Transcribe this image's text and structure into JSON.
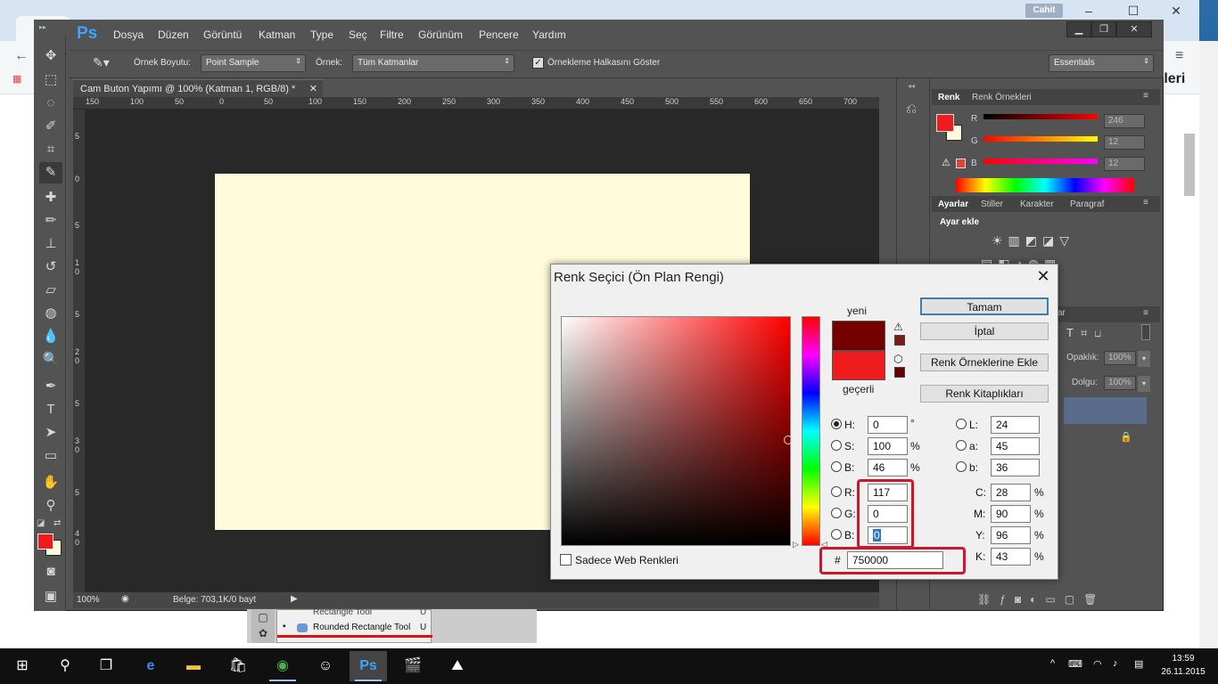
{
  "chrome": {
    "user_badge": "Cahit",
    "page_fragment": "tleri"
  },
  "ps": {
    "logo": "Ps",
    "menu": [
      "Dosya",
      "Düzen",
      "Görüntü",
      "Katman",
      "Type",
      "Seç",
      "Filtre",
      "Görünüm",
      "Pencere",
      "Yardım"
    ],
    "win_controls": [
      "min-icon",
      "restore-icon",
      "close-icon"
    ]
  },
  "options": {
    "sample_size_label": "Örnek Boyutu:",
    "sample_size_value": "Point Sample",
    "sample_label": "Örnek:",
    "sample_value": "Tüm Katmanlar",
    "ring_label": "Örnekleme Halkasını Göster",
    "workspace": "Essentials"
  },
  "document": {
    "tab_title": "Cam Buton Yapımı @ 100% (Katman 1, RGB/8) *",
    "ruler_h": [
      "150",
      "100",
      "50",
      "0",
      "50",
      "100",
      "150",
      "200",
      "250",
      "300",
      "350",
      "400",
      "450",
      "500",
      "550",
      "600",
      "650",
      "700"
    ],
    "ruler_v": [
      "5",
      "0",
      "5",
      "1",
      "0",
      "5",
      "2",
      "0",
      "5",
      "3",
      "0",
      "5",
      "4",
      "0"
    ],
    "zoom": "100%",
    "status": "Belge: 703,1K/0 bayt"
  },
  "panels": {
    "color_tabs": [
      "Renk",
      "Renk Örnekleri"
    ],
    "r_label": "R",
    "g_label": "G",
    "b_label": "B",
    "r_value": "246",
    "g_value": "12",
    "b_value": "12",
    "adj_tabs": [
      "Ayarlar",
      "Stiller",
      "Karakter",
      "Paragraf"
    ],
    "adj_add": "Ayar ekle",
    "layers_partial": "ar",
    "opacity_label": "Opaklık:",
    "opacity_value": "100%",
    "fill_label": "Dolgu:",
    "fill_value": "100%"
  },
  "dialog": {
    "title": "Renk Seçici (Ön Plan Rengi)",
    "new_label": "yeni",
    "current_label": "geçerli",
    "btn_ok": "Tamam",
    "btn_cancel": "İptal",
    "btn_add_swatch": "Renk Örneklerine Ekle",
    "btn_libraries": "Renk Kitaplıkları",
    "web_only": "Sadece Web Renkleri",
    "h_label": "H:",
    "h_value": "0",
    "h_unit": "°",
    "s_label": "S:",
    "s_value": "100",
    "s_unit": "%",
    "b_label": "B:",
    "b_value": "46",
    "b_unit": "%",
    "r_label": "R:",
    "r_value": "117",
    "g_label": "G:",
    "g_value": "0",
    "bl_label": "B:",
    "bl_value": "0",
    "l_label": "L:",
    "l_value": "24",
    "a_label": "a:",
    "a_value": "45",
    "b2_label": "b:",
    "b2_value": "36",
    "c_label": "C:",
    "c_value": "28",
    "c_unit": "%",
    "m_label": "M:",
    "m_value": "90",
    "m_unit": "%",
    "y_label": "Y:",
    "y_value": "96",
    "y_unit": "%",
    "k_label": "K:",
    "k_value": "43",
    "k_unit": "%",
    "hash": "#",
    "hex_value": "750000",
    "new_color": "#750000",
    "current_color": "#ee1c1c"
  },
  "below": {
    "item1": "Rectangle Tool",
    "item2": "Rounded Rectangle Tool",
    "item2_key": "U",
    "item1_key": "U"
  },
  "taskbar": {
    "time": "13:59",
    "date": "26.11.2015"
  }
}
